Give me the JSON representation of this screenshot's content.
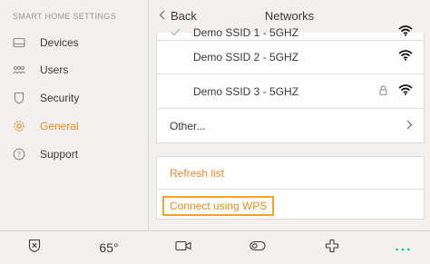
{
  "sidebar": {
    "title": "SMART HOME SETTINGS",
    "items": [
      {
        "label": "Devices",
        "icon": "devices-icon"
      },
      {
        "label": "Users",
        "icon": "users-icon"
      },
      {
        "label": "Security",
        "icon": "shield-icon"
      },
      {
        "label": "General",
        "icon": "gear-icon",
        "active": true
      },
      {
        "label": "Support",
        "icon": "help-icon"
      }
    ]
  },
  "header": {
    "back_label": "Back",
    "title": "Networks"
  },
  "networks": [
    {
      "ssid": "Demo SSID 1 - 5GHZ",
      "connected": true,
      "locked": false
    },
    {
      "ssid": "Demo SSID 2 - 5GHZ",
      "connected": false,
      "locked": false
    },
    {
      "ssid": "Demo SSID 3 - 5GHZ",
      "connected": false,
      "locked": true
    }
  ],
  "other_label": "Other...",
  "actions": {
    "refresh_label": "Refresh list",
    "wps_label": "Connect using WPS"
  },
  "bottombar": {
    "temperature": "65°"
  },
  "colors": {
    "accent": "#ef8a1f",
    "check": "#7cc3a3",
    "background": "#f2f1ef"
  }
}
